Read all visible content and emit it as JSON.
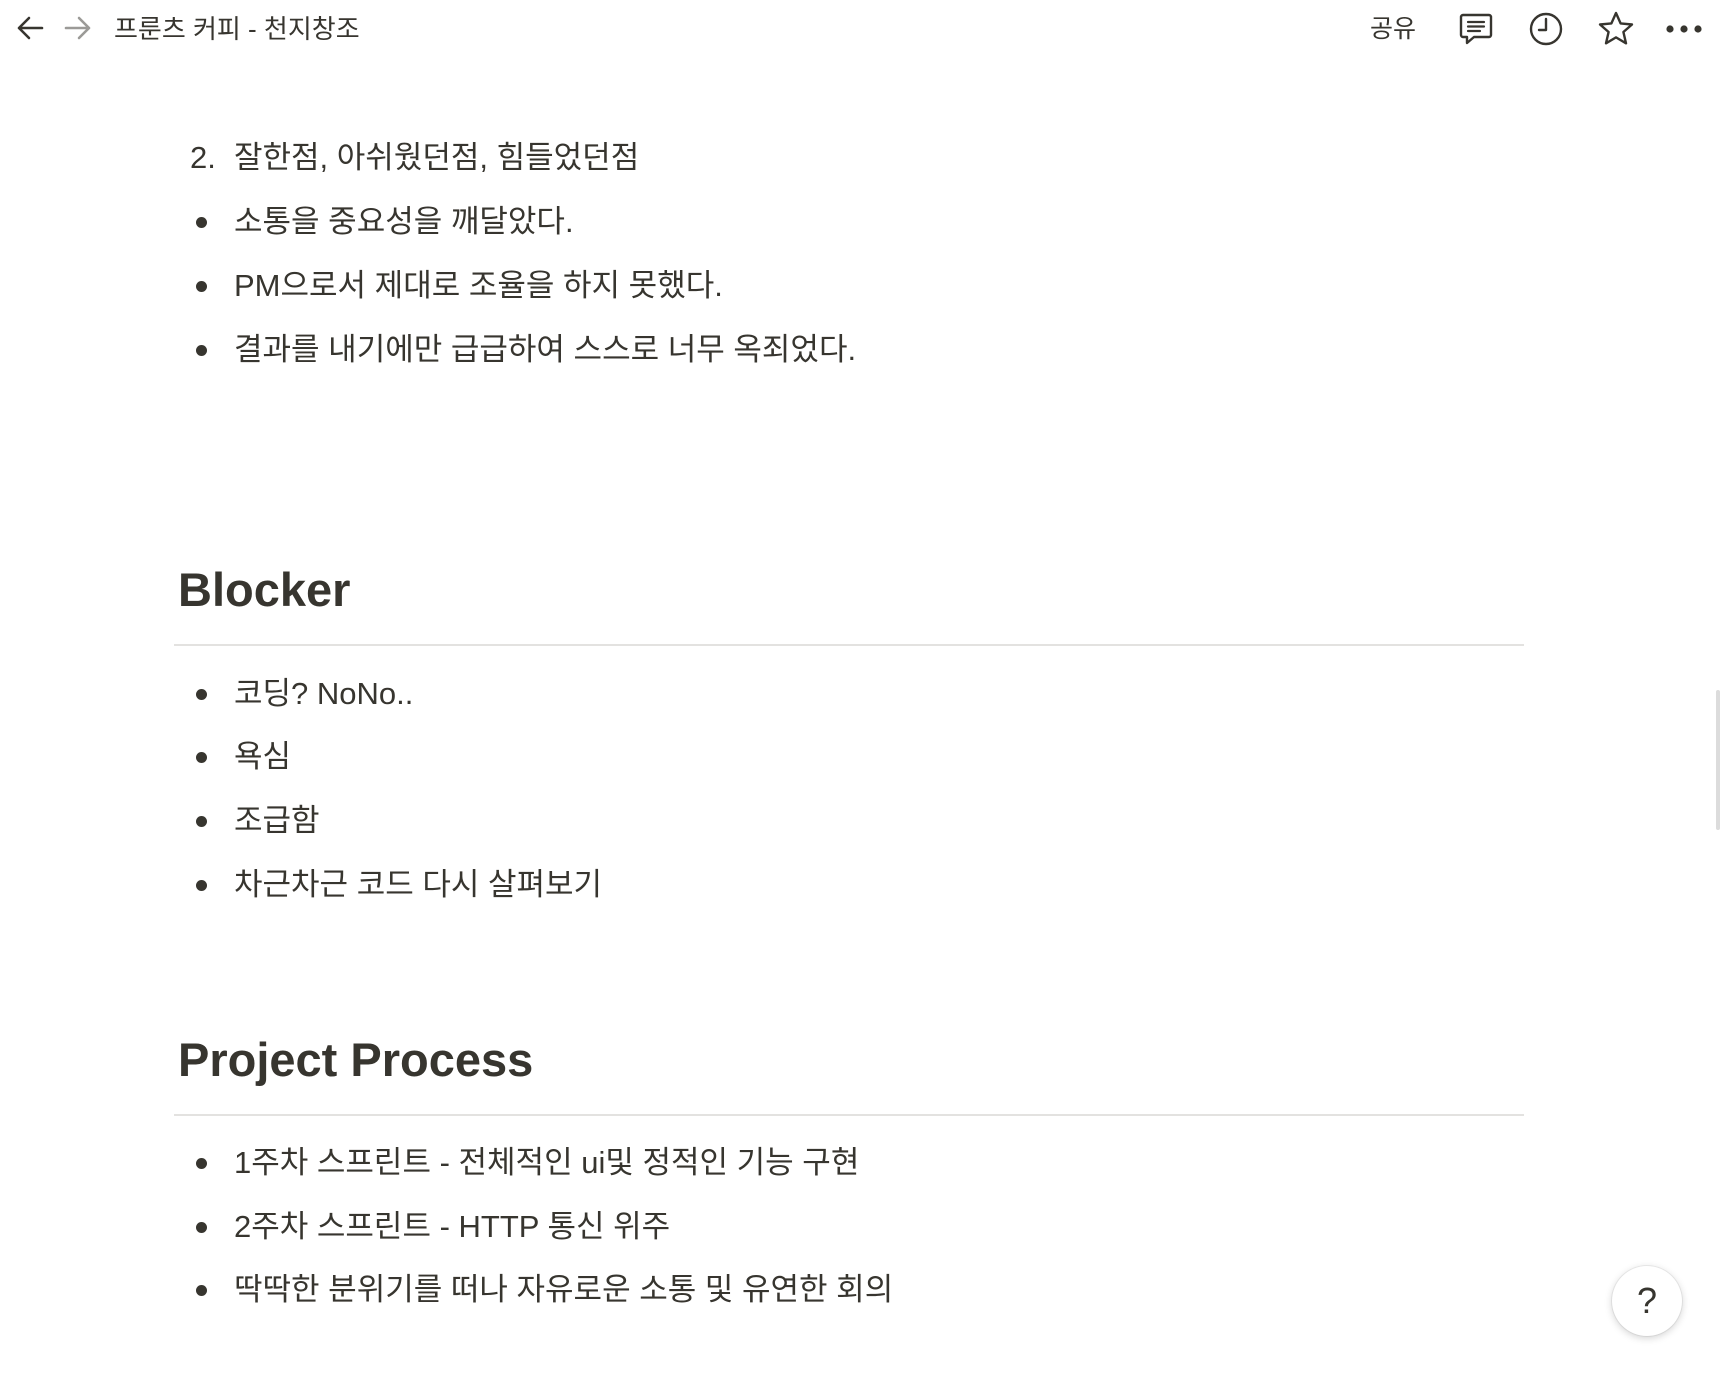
{
  "topbar": {
    "back_icon": "arrow-left-icon",
    "forward_icon": "arrow-right-icon",
    "breadcrumb": "프룬츠 커피 - 천지창조",
    "share_label": "공유",
    "comment_icon": "comment-icon",
    "history_icon": "clock-icon",
    "favorite_icon": "star-icon",
    "more_icon": "more-icon"
  },
  "section_retro": {
    "numbered_item": {
      "number": "2.",
      "text": "잘한점, 아쉬웠던점, 힘들었던점"
    },
    "bullets": [
      "소통을 중요성을 깨달았다.",
      "PM으로서 제대로 조율을 하지 못했다.",
      "결과를 내기에만 급급하여 스스로 너무 옥죄었다."
    ]
  },
  "section_blocker": {
    "title": "Blocker",
    "bullets": [
      "코딩? NoNo..",
      "욕심",
      "조급함",
      "차근차근 코드 다시 살펴보기"
    ]
  },
  "section_process": {
    "title": "Project Process",
    "bullets": [
      "1주차 스프린트 - 전체적인 ui및 정적인 기능 구현",
      "2주차 스프린트 - HTTP 통신 위주",
      "딱딱한 분위기를 떠나 자유로운 소통 및 유연한 회의"
    ]
  },
  "help_button": {
    "label": "?"
  }
}
